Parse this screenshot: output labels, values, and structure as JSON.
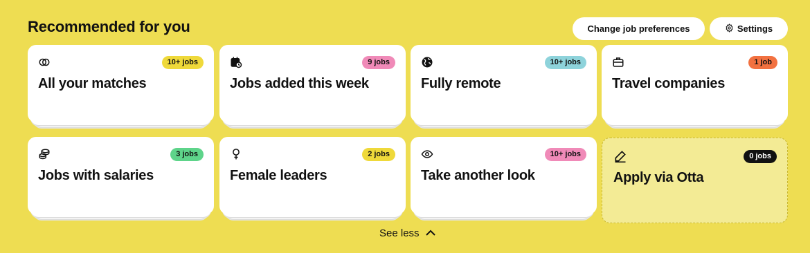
{
  "header": {
    "title": "Recommended for you",
    "change_prefs_label": "Change job preferences",
    "settings_label": "Settings"
  },
  "cards": [
    {
      "title": "All your matches",
      "badge": "10+ jobs",
      "badge_color": "#efd93a",
      "icon": "overlapping-circles-icon"
    },
    {
      "title": "Jobs added this week",
      "badge": "9 jobs",
      "badge_color": "#f08ab8",
      "icon": "calendar-clock-icon"
    },
    {
      "title": "Fully remote",
      "badge": "10+ jobs",
      "badge_color": "#8ed3db",
      "icon": "globe-icon"
    },
    {
      "title": "Travel companies",
      "badge": "1 job",
      "badge_color": "#f27140",
      "icon": "briefcase-icon"
    },
    {
      "title": "Jobs with salaries",
      "badge": "3 jobs",
      "badge_color": "#5ed48a",
      "icon": "coins-stack-icon"
    },
    {
      "title": "Female leaders",
      "badge": "2 jobs",
      "badge_color": "#efd93a",
      "icon": "female-symbol-icon"
    },
    {
      "title": "Take another look",
      "badge": "10+ jobs",
      "badge_color": "#f08ab8",
      "icon": "eye-icon"
    },
    {
      "title": "Apply via Otta",
      "badge": "0 jobs",
      "badge_color": "#111111",
      "icon": "pencil-icon"
    }
  ],
  "footer": {
    "see_less_label": "See less"
  }
}
